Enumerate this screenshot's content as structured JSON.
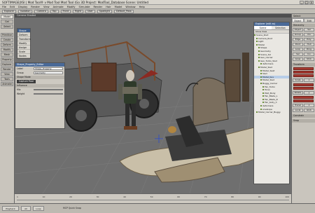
{
  "window": {
    "title": "SOFTIMAGE|XSI | Mod Tool® v Mod Tool Mod Tool (Go 3D Project: ModTool_Database   Scene: Untitled",
    "controls": [
      "_",
      "□",
      "×"
    ]
  },
  "menubar": [
    "File",
    "Edit",
    "Display",
    "Render",
    "View",
    "Animate",
    "Modify",
    "Simulate",
    "Render",
    "Hair",
    "Model",
    "Window",
    "Help"
  ],
  "toolbar": [
    "Explorer",
    "Isolation",
    "Camera",
    "Top",
    "Front",
    "Right",
    "User",
    "Spotlight",
    "Default_Pass"
  ],
  "leftpalette": {
    "items": [
      "Model",
      "Get",
      "Select",
      "Primitive",
      "Create",
      "Deform",
      "Modify",
      "Mesh",
      "Property",
      "Explorer",
      "Render",
      "View",
      "Tools",
      "Animate"
    ],
    "active": "Model"
  },
  "viewport": {
    "label": "Camera   Shaded"
  },
  "contextmenu": {
    "items": [
      "Shape",
      "Deform",
      "Transform",
      "Modify",
      "Assign",
      "Scale",
      "Nodes"
    ],
    "highlighted": "Shape"
  },
  "propedit": {
    "title": "Shape_Property_Editor",
    "rows": [
      {
        "label": "Label",
        "value": "Shape_Property"
      },
      {
        "label": "Group",
        "value": "Geometry"
      }
    ],
    "section1": "Shape Mode",
    "button": "Capture Pose",
    "section2": "Influence",
    "rows2": [
      {
        "label": "Mix",
        "value": ""
      },
      {
        "label": "Weight",
        "value": ""
      }
    ]
  },
  "explorer": {
    "title": "Explorer  (edit as)",
    "tabs": [
      "Scene",
      "Selection"
    ],
    "tab_active": "Scene",
    "bar": "Show  View",
    "items": [
      "Scene_Root",
      "Camera_Root",
      "Light",
      "Model",
      "Shape",
      "Geometry",
      "Scene_Sol",
      "Geo_Carrier",
      "Geo_Turbo_Sled",
      "deformers",
      "Model_Sled",
      "Model_Seat",
      "Sled",
      "Model_bus",
      "Model_Sled",
      "Buggy_Carrier",
      "Fan_Turbo",
      "Torso",
      "Pilot_Body",
      "Fan_Blade_L",
      "Fan_Blade_R",
      "Fan_body_C",
      "deformers",
      "envelope",
      "Model_Carrier_Buggy"
    ],
    "selected": "Model_bus"
  },
  "rightpanel": {
    "header": "Select",
    "tabs": [
      "Object",
      "Edit"
    ],
    "tab_active": "Object",
    "sections": [
      "Hierarchy",
      "Transform",
      "Constrain",
      "Snap"
    ],
    "buttons": [
      [
        "Object",
        "Sel"
      ],
      [
        "Group",
        "Clu"
      ],
      [
        "Edge",
        "Poly"
      ],
      [
        "Point",
        "Hull"
      ],
      [
        "Loop",
        "Ring"
      ],
      [
        "Sel",
        "Inv"
      ],
      [
        "Grow",
        "Shrk"
      ]
    ],
    "transform_buttons": [
      [
        "Scale",
        "x"
      ],
      [
        "Rotate",
        "y"
      ],
      [
        "Transl",
        "z"
      ],
      [
        "Local",
        "Glob"
      ]
    ]
  },
  "timeline": {
    "ticks": [
      "1",
      "10",
      "20",
      "30",
      "40",
      "50",
      "60",
      "70",
      "80",
      "90",
      "100"
    ]
  },
  "statusbar": {
    "text": "MCP  Quick Snap",
    "buttons": [
      "Playback",
      "All",
      "Loop"
    ]
  }
}
